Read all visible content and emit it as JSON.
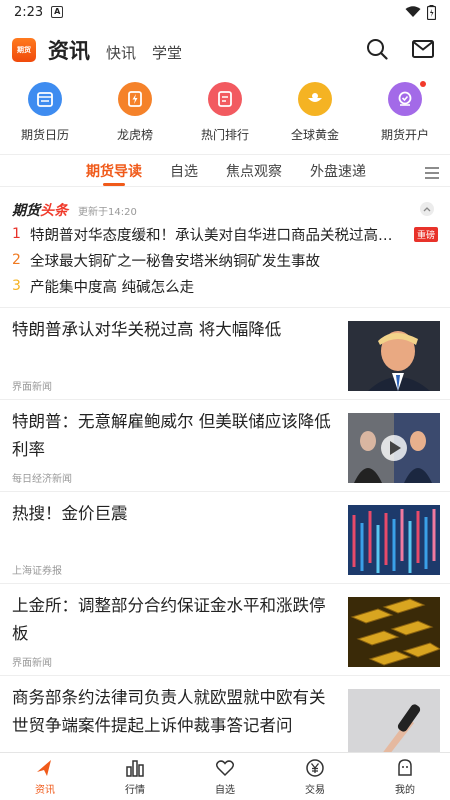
{
  "status": {
    "time": "2:23",
    "a_icon": "A"
  },
  "header": {
    "logo_text": "期货",
    "title": "资讯",
    "tabs": [
      "快讯",
      "学堂"
    ]
  },
  "quick_menu": [
    {
      "label": "期货日历",
      "icon": "calendar-icon",
      "color": "#3e8cf0"
    },
    {
      "label": "龙虎榜",
      "icon": "ranking-icon",
      "color": "#f5822a"
    },
    {
      "label": "热门排行",
      "icon": "hot-list-icon",
      "color": "#f25a60"
    },
    {
      "label": "全球黄金",
      "icon": "gold-icon",
      "color": "#f5b323"
    },
    {
      "label": "期货开户",
      "icon": "account-icon",
      "color": "#a36ae8"
    }
  ],
  "sub_tabs": [
    "期货导读",
    "自选",
    "焦点观察",
    "外盘速递"
  ],
  "headlines": {
    "brand_prefix": "期货",
    "brand_accent": "头条",
    "updated": "更新于14:20",
    "items": [
      {
        "rank": "1",
        "rank_color": "#e8322a",
        "text": "特朗普对华态度缓和！承认美对自华进口商品关税过高…",
        "badge": "重磅"
      },
      {
        "rank": "2",
        "rank_color": "#f07a22",
        "text": "全球最大铜矿之一秘鲁安塔米纳铜矿发生事故",
        "badge": ""
      },
      {
        "rank": "3",
        "rank_color": "#f5b323",
        "text": "产能集中度高 纯碱怎么走",
        "badge": ""
      }
    ]
  },
  "news": [
    {
      "title": "特朗普承认对华关税过高 将大幅降低",
      "source": "界面新闻",
      "thumb": "trump-photo"
    },
    {
      "title": "特朗普：无意解雇鲍威尔 但美联储应该降低利率",
      "source": "每日经济新闻",
      "thumb": "video-thumb"
    },
    {
      "title": "热搜！金价巨震",
      "source": "上海证券报",
      "thumb": "market-screen"
    },
    {
      "title": "上金所：调整部分合约保证金水平和涨跌停板",
      "source": "界面新闻",
      "thumb": "gold-bars"
    },
    {
      "title": "商务部条约法律司负责人就欧盟就中欧有关世贸争端案件提起上诉仲裁事答记者问",
      "source": "",
      "thumb": "microphone"
    }
  ],
  "bottom_nav": [
    {
      "label": "资讯",
      "active": true
    },
    {
      "label": "行情",
      "active": false
    },
    {
      "label": "自选",
      "active": false
    },
    {
      "label": "交易",
      "active": false
    },
    {
      "label": "我的",
      "active": false
    }
  ],
  "colors": {
    "accent": "#f05a1a",
    "red": "#e8322a"
  }
}
